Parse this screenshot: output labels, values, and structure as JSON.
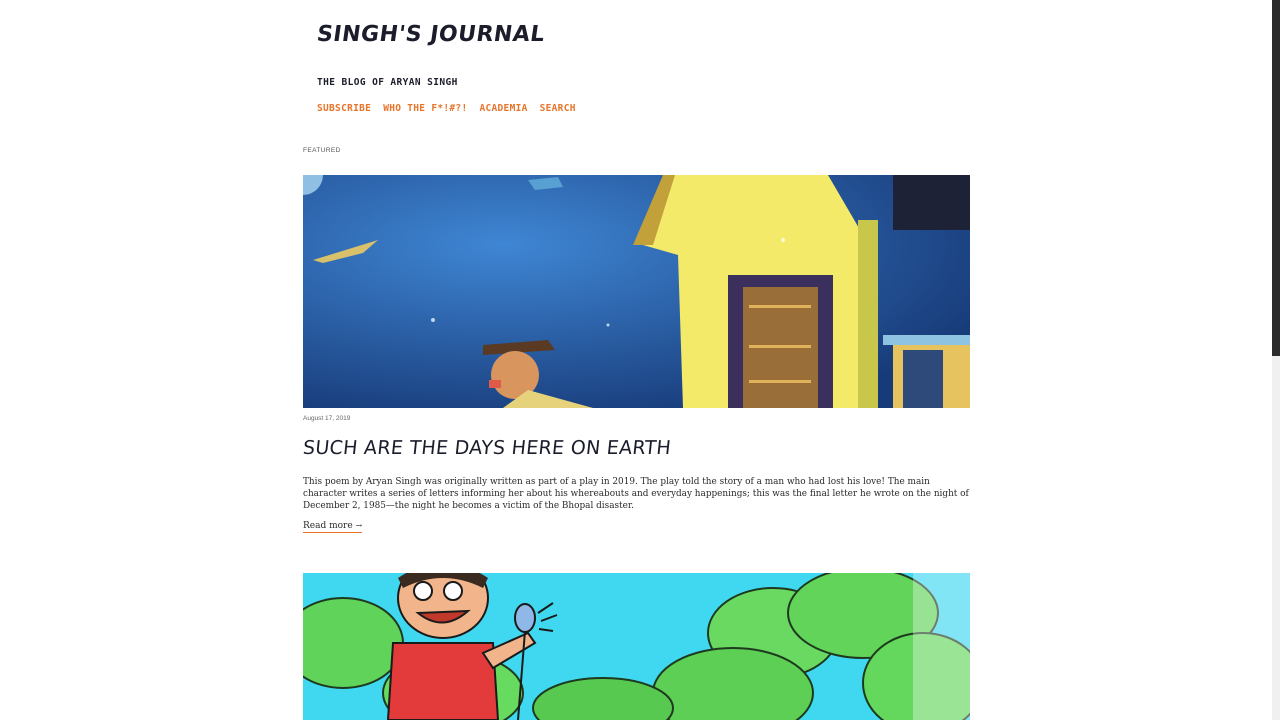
{
  "site": {
    "title": "SINGH's JOURNAL",
    "tagline": "THE BLOG OF ARYAN SINGH"
  },
  "nav": {
    "items": [
      {
        "label": "SUBSCRIBE"
      },
      {
        "label": "WHO THE F*!#?!"
      },
      {
        "label": "ACADEMIA"
      },
      {
        "label": "SEARCH"
      }
    ]
  },
  "featured": {
    "section_label": "FEATURED",
    "date": "August 17, 2019",
    "title": "SUCH ARE THE DAYS HERE ON EARTH",
    "excerpt": "This poem by Aryan Singh was originally written as part of a play in 2019. The play told the story of a man who had lost his love! The main character writes a series of letters informing her about his whereabouts and everyday happenings; this was the final letter he wrote on the night of December 2, 1985—the night he becomes a victim of the Bhopal disaster.",
    "read_more": "Read more",
    "read_more_arrow": "→"
  },
  "colors": {
    "accent": "#e8742a",
    "text": "#1b1d2b",
    "scrollbar": "#2b2b2b"
  },
  "icons": [
    "arrow-right-icon"
  ]
}
